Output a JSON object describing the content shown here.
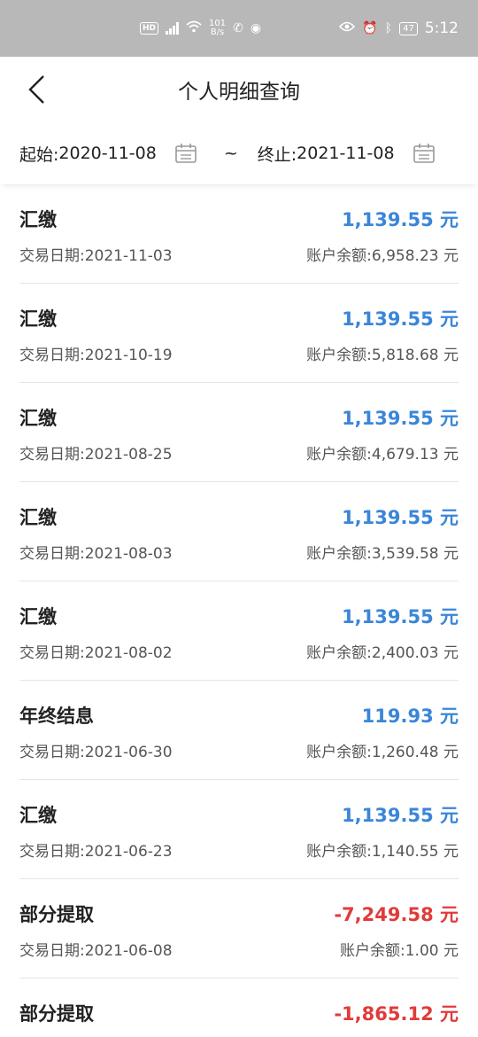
{
  "status": {
    "net_speed_top": "101",
    "net_speed_bottom": "B/s",
    "battery": "47",
    "time": "5:12"
  },
  "nav": {
    "title": "个人明细查询"
  },
  "filter": {
    "start_label": "起始:",
    "start_date": "2020-11-08",
    "separator": "~",
    "end_label": "终止:",
    "end_date": "2021-11-08"
  },
  "labels": {
    "date_prefix": "交易日期:",
    "balance_prefix": "账户余额:",
    "unit": "元"
  },
  "transactions": [
    {
      "type": "汇缴",
      "amount": "1,139.55 元",
      "date": "交易日期:2021-11-03",
      "balance": "账户余额:6,958.23 元",
      "sign": "pos"
    },
    {
      "type": "汇缴",
      "amount": "1,139.55 元",
      "date": "交易日期:2021-10-19",
      "balance": "账户余额:5,818.68 元",
      "sign": "pos"
    },
    {
      "type": "汇缴",
      "amount": "1,139.55 元",
      "date": "交易日期:2021-08-25",
      "balance": "账户余额:4,679.13 元",
      "sign": "pos"
    },
    {
      "type": "汇缴",
      "amount": "1,139.55 元",
      "date": "交易日期:2021-08-03",
      "balance": "账户余额:3,539.58 元",
      "sign": "pos"
    },
    {
      "type": "汇缴",
      "amount": "1,139.55 元",
      "date": "交易日期:2021-08-02",
      "balance": "账户余额:2,400.03 元",
      "sign": "pos"
    },
    {
      "type": "年终结息",
      "amount": "119.93 元",
      "date": "交易日期:2021-06-30",
      "balance": "账户余额:1,260.48 元",
      "sign": "pos"
    },
    {
      "type": "汇缴",
      "amount": "1,139.55 元",
      "date": "交易日期:2021-06-23",
      "balance": "账户余额:1,140.55 元",
      "sign": "pos"
    },
    {
      "type": "部分提取",
      "amount": "-7,249.58 元",
      "date": "交易日期:2021-06-08",
      "balance": "账户余额:1.00 元",
      "sign": "neg"
    },
    {
      "type": "部分提取",
      "amount": "-1,865.12 元",
      "date": "",
      "balance": "",
      "sign": "neg"
    }
  ]
}
